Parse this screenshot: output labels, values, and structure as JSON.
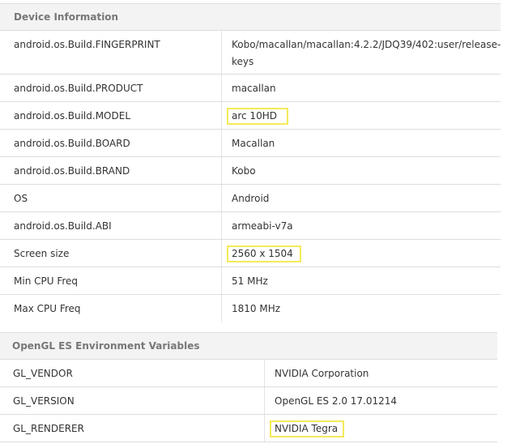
{
  "device": {
    "header": "Device Information",
    "rows": [
      {
        "key": "android.os.Build.FINGERPRINT",
        "value_line1": "Kobo/macallan/macallan:4.2.2/JDQ39/402:user/release-",
        "value_line2": "keys"
      },
      {
        "key": "android.os.Build.PRODUCT",
        "value": "macallan"
      },
      {
        "key": "android.os.Build.MODEL",
        "value": "arc 10HD"
      },
      {
        "key": "android.os.Build.BOARD",
        "value": "Macallan"
      },
      {
        "key": "android.os.Build.BRAND",
        "value": "Kobo"
      },
      {
        "key": "OS",
        "value": "Android"
      },
      {
        "key": "android.os.Build.ABI",
        "value": "armeabi-v7a"
      },
      {
        "key": "Screen size",
        "value": "2560 x 1504"
      },
      {
        "key": "Min CPU Freq",
        "value": "51 MHz"
      },
      {
        "key": "Max CPU Freq",
        "value": "1810 MHz"
      }
    ]
  },
  "opengl": {
    "header": "OpenGL ES Environment Variables",
    "rows": [
      {
        "key": "GL_VENDOR",
        "value": "NVIDIA Corporation"
      },
      {
        "key": "GL_VERSION",
        "value": "OpenGL ES 2.0 17.01214"
      },
      {
        "key": "GL_RENDERER",
        "value": "NVIDIA Tegra"
      }
    ]
  },
  "colors": {
    "highlight_border": "#f5ea5a",
    "header_bg": "#f3f3f3",
    "border": "#dddddd"
  }
}
